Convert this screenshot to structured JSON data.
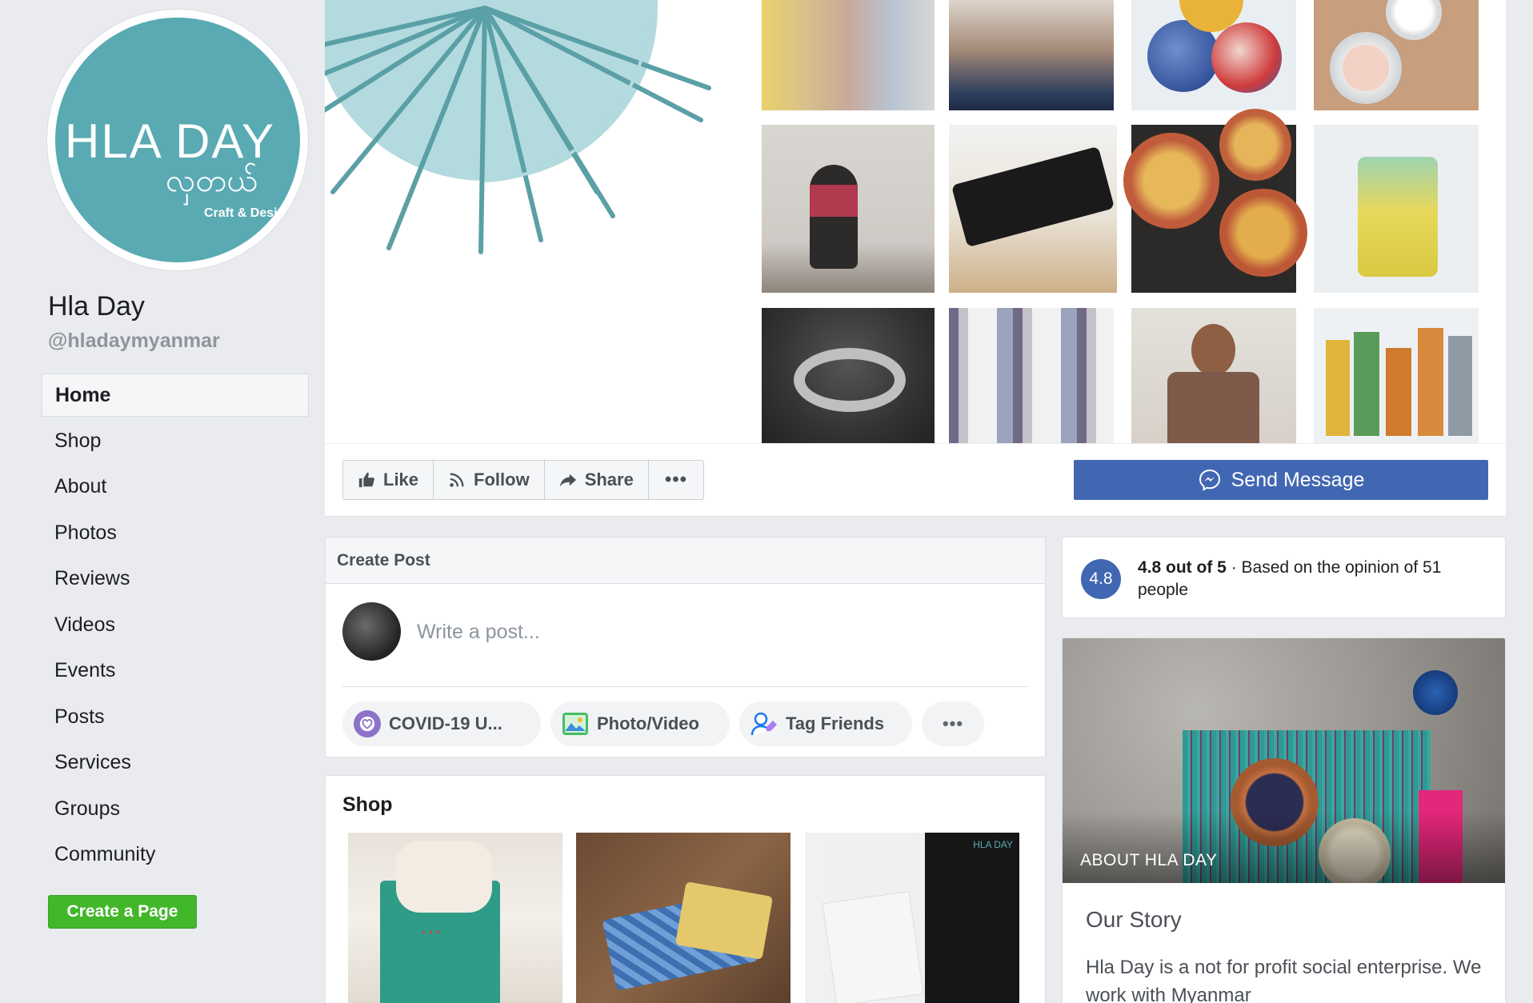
{
  "page": {
    "name": "Hla Day",
    "handle": "@hladaymyanmar",
    "logo": {
      "main": "HLA DAY",
      "script": "လှတယ်",
      "sub": "Craft & Design",
      "color": "#5aaab3"
    }
  },
  "sidebar": {
    "items": [
      {
        "label": "Home",
        "active": true
      },
      {
        "label": "Shop"
      },
      {
        "label": "About"
      },
      {
        "label": "Photos"
      },
      {
        "label": "Reviews"
      },
      {
        "label": "Videos"
      },
      {
        "label": "Events"
      },
      {
        "label": "Posts"
      },
      {
        "label": "Services"
      },
      {
        "label": "Groups"
      },
      {
        "label": "Community"
      }
    ],
    "create_page_label": "Create a Page"
  },
  "actions": {
    "like": "Like",
    "follow": "Follow",
    "share": "Share",
    "more_icon": "ellipsis-icon",
    "send_message": "Send Message"
  },
  "create_post": {
    "header": "Create Post",
    "placeholder": "Write a post...",
    "chips": [
      {
        "label": "COVID-19 U...",
        "icon": "heart-icon"
      },
      {
        "label": "Photo/Video",
        "icon": "photo-icon"
      },
      {
        "label": "Tag Friends",
        "icon": "tag-friends-icon"
      }
    ]
  },
  "shop": {
    "title": "Shop",
    "item_label_3": "HLA DAY"
  },
  "rating": {
    "score": "4.8",
    "bold": "4.8 out of 5",
    "rest": " · Based on the opinion of 51 people"
  },
  "about": {
    "photo_label": "ABOUT HLA DAY",
    "story_title": "Our Story",
    "story_text": "Hla Day is a not for profit social enterprise. We work with Myanmar"
  },
  "colors": {
    "brand_blue": "#4267b2",
    "create_green": "#42b72a",
    "background": "#e9ebee"
  }
}
